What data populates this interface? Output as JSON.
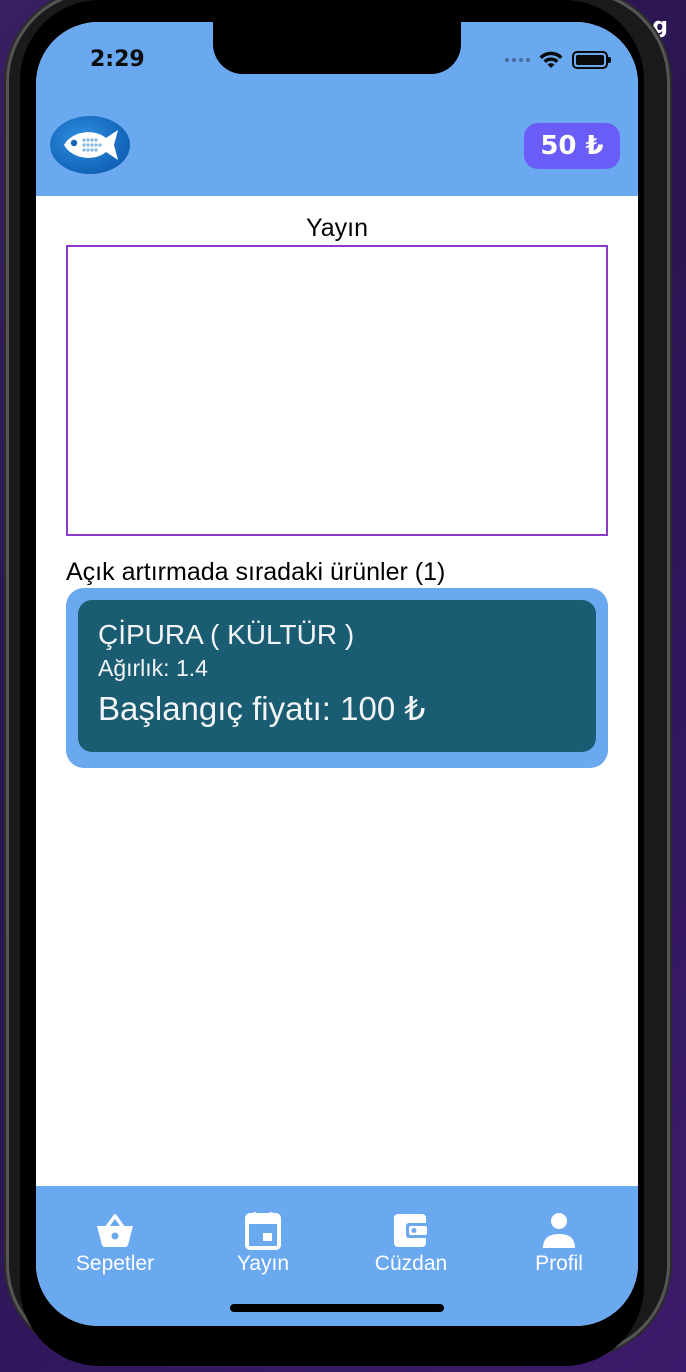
{
  "background": {
    "corner_text": "ng"
  },
  "status_bar": {
    "time": "2:29",
    "icons": [
      "signal-dots-icon",
      "wifi-icon",
      "battery-icon"
    ]
  },
  "header": {
    "logo_icon": "fish-logo-icon",
    "balance": "50 ₺",
    "background_color": "#6aa8f0",
    "badge_color": "#6a5cf6"
  },
  "stream": {
    "title": "Yayın"
  },
  "queue": {
    "title": "Açık artırmada sıradaki ürünler (1)",
    "items": [
      {
        "name": "ÇİPURA ( KÜLTÜR )",
        "weight": "Ağırlık: 1.4",
        "price": "Başlangıç fiyatı: 100 ₺"
      }
    ]
  },
  "colors": {
    "card_outer": "#6aa8f0",
    "card_inner": "#1a5d73",
    "stream_border": "#8a3cc9"
  },
  "tab_bar": {
    "tabs": [
      {
        "label": "Sepetler",
        "icon": "basket-icon"
      },
      {
        "label": "Yayın",
        "icon": "calendar-icon"
      },
      {
        "label": "Cüzdan",
        "icon": "wallet-icon"
      },
      {
        "label": "Profil",
        "icon": "person-icon"
      }
    ]
  }
}
